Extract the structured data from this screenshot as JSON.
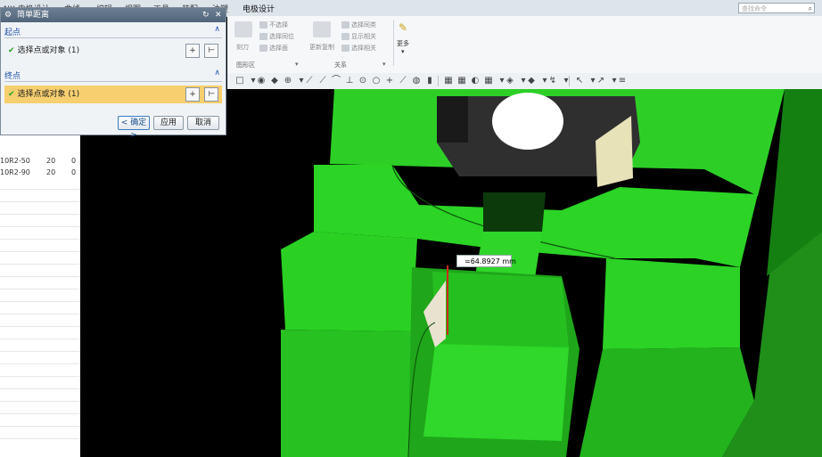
{
  "menu": {
    "items": [
      "NX 电极设计",
      "曲线",
      "编辑",
      "视图",
      "工具",
      "装配",
      "注塑",
      "电极设计"
    ],
    "search_placeholder": "查找命令"
  },
  "ribbon": {
    "group1": {
      "buttons": [
        "刻刀",
        "不选择",
        "选择同位",
        "选择面"
      ],
      "label": "图形区"
    },
    "group2": {
      "buttons": [
        "更新复制",
        "选择同类",
        "显示相关",
        "选择相关"
      ],
      "label": "关系"
    },
    "more_label": "更多"
  },
  "dialog": {
    "title": "简单距离",
    "start_section": "起点",
    "start_value": "选择点或对象 (1)",
    "end_section": "终点",
    "end_value": "选择点或对象 (1)",
    "ok_label": "< 确定 >",
    "apply_label": "应用",
    "cancel_label": "取消"
  },
  "left_list": {
    "rows": [
      {
        "name": "10R2-50",
        "col2": "20",
        "col3": "0"
      },
      {
        "name": "10R2-90",
        "col2": "20",
        "col3": "0"
      }
    ]
  },
  "measure": {
    "value": "=64.8927 mm"
  },
  "colors": {
    "model_green": "#22c41e",
    "selection_orange": "#f7cf6e",
    "viewport_bg": "#000000"
  }
}
